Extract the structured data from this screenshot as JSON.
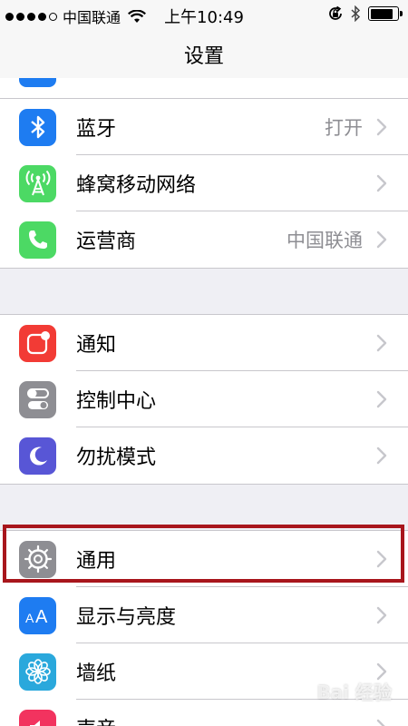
{
  "status_bar": {
    "carrier": "中国联通",
    "time": "上午10:49",
    "signal_dots_filled": 4,
    "signal_dots_total": 5,
    "battery_level": 0.85
  },
  "nav": {
    "title": "设置"
  },
  "groups": [
    {
      "rows": [
        {
          "id": "bluetooth",
          "label": "蓝牙",
          "value": "打开",
          "icon": "bluetooth-icon",
          "color": "#1e7cf1"
        },
        {
          "id": "cellular",
          "label": "蜂窝移动网络",
          "value": "",
          "icon": "cellular-antenna-icon",
          "color": "#4cd964"
        },
        {
          "id": "carrier",
          "label": "运营商",
          "value": "中国联通",
          "icon": "phone-icon",
          "color": "#4cd964"
        }
      ]
    },
    {
      "rows": [
        {
          "id": "notifications",
          "label": "通知",
          "value": "",
          "icon": "notification-icon",
          "color": "#f23b35"
        },
        {
          "id": "control-center",
          "label": "控制中心",
          "value": "",
          "icon": "toggle-switches-icon",
          "color": "#8e8e93"
        },
        {
          "id": "do-not-disturb",
          "label": "勿扰模式",
          "value": "",
          "icon": "moon-icon",
          "color": "#5856d6"
        }
      ]
    },
    {
      "rows": [
        {
          "id": "general",
          "label": "通用",
          "value": "",
          "icon": "gear-icon",
          "color": "#8e8e93"
        },
        {
          "id": "display",
          "label": "显示与亮度",
          "value": "",
          "icon": "text-size-icon",
          "color": "#1e7cf1"
        },
        {
          "id": "wallpaper",
          "label": "墙纸",
          "value": "",
          "icon": "flower-icon",
          "color": "#2aa8dc"
        },
        {
          "id": "sounds",
          "label": "声音",
          "value": "",
          "icon": "speaker-icon",
          "color": "#f2335f"
        }
      ]
    }
  ],
  "watermark": "Bai 经验"
}
